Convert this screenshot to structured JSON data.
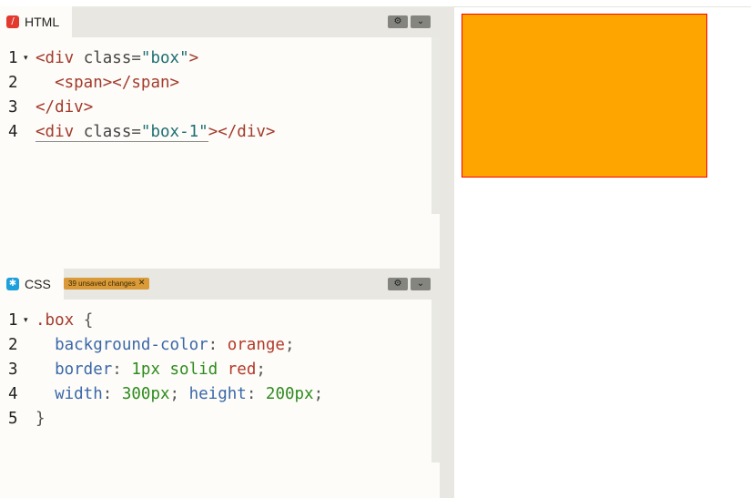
{
  "html_pane": {
    "tab_label": "HTML",
    "tab_icon": "slash-icon",
    "settings_icon": "gear-icon",
    "collapse_icon": "chevron-down-icon",
    "lines": [
      {
        "n": "1",
        "fold": "▾",
        "tokens": [
          {
            "t": "<",
            "c": "t-tag"
          },
          {
            "t": "div",
            "c": "t-tag"
          },
          {
            "t": " class",
            "c": "t-attr"
          },
          {
            "t": "=",
            "c": "t-punct"
          },
          {
            "t": "\"box\"",
            "c": "t-str"
          },
          {
            "t": ">",
            "c": "t-tag"
          }
        ]
      },
      {
        "n": "2",
        "fold": "",
        "tokens": [
          {
            "t": "  <",
            "c": "t-tag"
          },
          {
            "t": "span",
            "c": "t-tag"
          },
          {
            "t": "></",
            "c": "t-tag"
          },
          {
            "t": "span",
            "c": "t-tag"
          },
          {
            "t": ">",
            "c": "t-tag"
          }
        ]
      },
      {
        "n": "3",
        "fold": "",
        "tokens": [
          {
            "t": "</",
            "c": "t-tag"
          },
          {
            "t": "div",
            "c": "t-tag"
          },
          {
            "t": ">",
            "c": "t-tag"
          }
        ]
      },
      {
        "n": "4",
        "fold": "",
        "tokens": [
          {
            "t": "<",
            "c": "t-tag"
          },
          {
            "t": "div",
            "c": "t-tag"
          },
          {
            "t": " class",
            "c": "t-attr"
          },
          {
            "t": "=",
            "c": "t-punct"
          },
          {
            "t": "\"box-1\"",
            "c": "t-str"
          },
          {
            "t": "></",
            "c": "t-tag"
          },
          {
            "t": "div",
            "c": "t-tag"
          },
          {
            "t": ">",
            "c": "t-tag"
          }
        ]
      }
    ]
  },
  "css_pane": {
    "tab_label": "CSS",
    "tab_icon": "asterisk-icon",
    "unsaved_badge": "39 unsaved changes",
    "settings_icon": "gear-icon",
    "collapse_icon": "chevron-down-icon",
    "lines": [
      {
        "n": "1",
        "fold": "▾",
        "tokens": [
          {
            "t": ".box",
            "c": "t-sel"
          },
          {
            "t": " {",
            "c": "t-punct"
          }
        ]
      },
      {
        "n": "2",
        "fold": "",
        "tokens": [
          {
            "t": "  background-color",
            "c": "t-prop"
          },
          {
            "t": ": ",
            "c": "t-punct"
          },
          {
            "t": "orange",
            "c": "t-val-kw"
          },
          {
            "t": ";",
            "c": "t-punct"
          }
        ]
      },
      {
        "n": "3",
        "fold": "",
        "tokens": [
          {
            "t": "  border",
            "c": "t-prop"
          },
          {
            "t": ": ",
            "c": "t-punct"
          },
          {
            "t": "1px",
            "c": "t-num"
          },
          {
            "t": " solid ",
            "c": "t-num"
          },
          {
            "t": "red",
            "c": "t-val-kw"
          },
          {
            "t": ";",
            "c": "t-punct"
          }
        ]
      },
      {
        "n": "4",
        "fold": "",
        "tokens": [
          {
            "t": "  width",
            "c": "t-prop"
          },
          {
            "t": ": ",
            "c": "t-punct"
          },
          {
            "t": "300px",
            "c": "t-num"
          },
          {
            "t": "; ",
            "c": "t-punct"
          },
          {
            "t": "height",
            "c": "t-prop"
          },
          {
            "t": ": ",
            "c": "t-punct"
          },
          {
            "t": "200px",
            "c": "t-num"
          },
          {
            "t": ";",
            "c": "t-punct"
          }
        ]
      },
      {
        "n": "5",
        "fold": "",
        "tokens": [
          {
            "t": "}",
            "c": "t-punct"
          }
        ]
      }
    ]
  },
  "preview": {
    "box_background": "#ffa500",
    "box_border": "#ff0000"
  }
}
